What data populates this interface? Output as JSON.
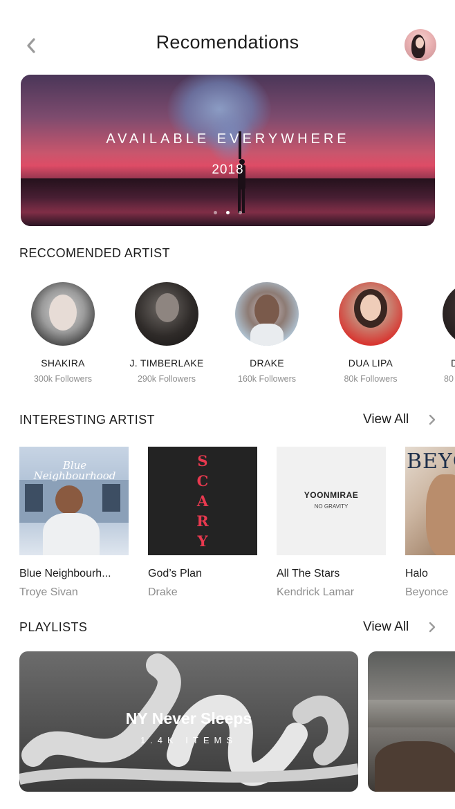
{
  "header": {
    "title": "Recomendations",
    "back_icon": "chevron-left-icon",
    "avatar_icon": "user-avatar"
  },
  "banner": {
    "title": "AVAILABLE EVERYWHERE",
    "subtitle": "2018",
    "active_slide": 2,
    "slide_count": 3
  },
  "recommended": {
    "title": "RECCOMENDED ARTIST",
    "artists": [
      {
        "name": "SHAKIRA",
        "followers": "300k Followers"
      },
      {
        "name": "J. TIMBERLAKE",
        "followers": "290k Followers"
      },
      {
        "name": "DRAKE",
        "followers": "160k Followers"
      },
      {
        "name": "DUA LIPA",
        "followers": "80k Followers"
      },
      {
        "name": "D",
        "followers": "80"
      }
    ]
  },
  "interesting": {
    "title": "INTERESTING ARTIST",
    "view_all": "View All",
    "items": [
      {
        "title": "Blue Neighbourh...",
        "artist": "Troye Sivan",
        "cover_text": "Blue Neighbourhood"
      },
      {
        "title": "God’s Plan",
        "artist": "Drake",
        "cover_text": "SCARY"
      },
      {
        "title": "All The Stars",
        "artist": "Kendrick Lamar",
        "cover_text": "YOONMIRAE",
        "cover_sub": "NO GRAVITY"
      },
      {
        "title": "Halo",
        "artist": "Beyonce",
        "cover_text": "BEYO"
      }
    ]
  },
  "playlists": {
    "title": "PLAYLISTS",
    "view_all": "View All",
    "items": [
      {
        "title": "NY Never Sleeps",
        "subtitle": "1.4K ITEMS"
      }
    ]
  },
  "colors": {
    "text": "#1d1d1d",
    "muted": "#8e8e8e",
    "background": "#ffffff"
  }
}
